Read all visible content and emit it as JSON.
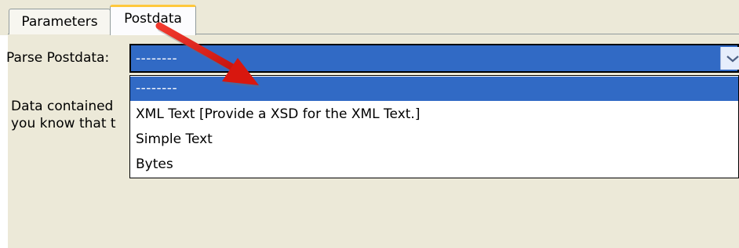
{
  "tabs": [
    {
      "label": "Parameters",
      "active": false
    },
    {
      "label": "Postdata",
      "active": true
    }
  ],
  "parse_field": {
    "label": "Parse Postdata:",
    "selected_value": "--------"
  },
  "description": {
    "line1": "Data contained",
    "line2": "you know that t"
  },
  "dropdown": {
    "options": [
      "--------",
      "XML Text  [Provide a XSD for the XML Text.]",
      "Simple Text",
      "Bytes"
    ],
    "highlighted_index": 0
  },
  "icons": {
    "combo_arrow": "chevron-down-icon",
    "annotation": "red-arrow-icon"
  },
  "colors": {
    "selection": "#316ac5",
    "panel_background": "#ece9d8",
    "active_tab_accent": "#ffc83c",
    "annotation_arrow": "#e8201a"
  }
}
